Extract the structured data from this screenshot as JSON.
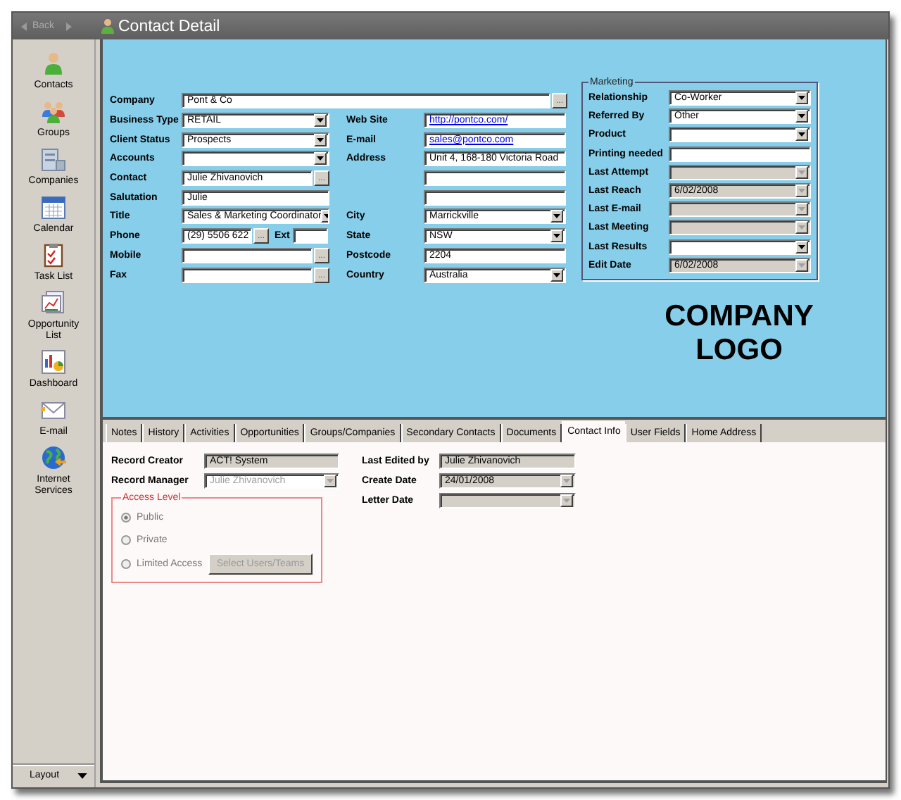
{
  "title_bar": {
    "back": "Back",
    "title": "Contact Detail"
  },
  "sidebar": {
    "items": [
      {
        "label": "Contacts"
      },
      {
        "label": "Groups"
      },
      {
        "label": "Companies"
      },
      {
        "label": "Calendar"
      },
      {
        "label": "Task List"
      },
      {
        "label": "Opportunity List"
      },
      {
        "label": "Dashboard"
      },
      {
        "label": "E-mail"
      },
      {
        "label": "Internet Services"
      }
    ],
    "layout_button": "Layout"
  },
  "company": {
    "label": "Company",
    "value": "Pont & Co",
    "kind": "lookup",
    "button": "..."
  },
  "contact_fields": [
    {
      "label": "Business Type",
      "value": "RETAIL",
      "kind": "combo"
    },
    {
      "label": "Client Status",
      "value": "Prospects",
      "kind": "combo"
    },
    {
      "label": "Accounts",
      "kind": "combo"
    },
    {
      "label": "Contact",
      "value": "Julie Zhivanovich",
      "kind": "lookup",
      "button": "..."
    },
    {
      "label": "Salutation",
      "value": "Julie",
      "kind": "text"
    },
    {
      "label": "Title",
      "value": "Sales & Marketing Coordinator",
      "kind": "combo"
    },
    {
      "label": "Phone",
      "value": "(29) 5506 622",
      "kind": "phone",
      "button": "...",
      "ext_label": "Ext"
    },
    {
      "label": "Mobile",
      "kind": "lookup",
      "button": "..."
    },
    {
      "label": "Fax",
      "kind": "lookup",
      "button": "..."
    }
  ],
  "address_fields": [
    {
      "label": "Web Site",
      "value": "http://pontco.com/",
      "kind": "link"
    },
    {
      "label": "E-mail",
      "value": "sales@pontco.com",
      "kind": "link"
    },
    {
      "label": "Address",
      "value": "Unit 4, 168-180 Victoria Road",
      "kind": "text"
    },
    {
      "kind": "text"
    },
    {
      "kind": "text"
    },
    {
      "label": "City",
      "value": "Marrickville",
      "kind": "combo"
    },
    {
      "label": "State",
      "value": "NSW",
      "kind": "combo"
    },
    {
      "label": "Postcode",
      "value": "2204",
      "kind": "text"
    },
    {
      "label": "Country",
      "value": "Australia",
      "kind": "combo"
    }
  ],
  "marketing": {
    "title": "Marketing",
    "fields": [
      {
        "label": "Relationship",
        "value": "Co-Worker",
        "kind": "combo",
        "read_only": false
      },
      {
        "label": "Referred By",
        "value": "Other",
        "kind": "combo",
        "read_only": false
      },
      {
        "label": "Product",
        "kind": "combo",
        "read_only": false
      },
      {
        "label": "Printing needed",
        "kind": "text",
        "read_only": false
      },
      {
        "label": "Last Attempt",
        "kind": "combo",
        "read_only": true
      },
      {
        "label": "Last Reach",
        "value": "6/02/2008",
        "kind": "combo",
        "read_only": true
      },
      {
        "label": "Last E-mail",
        "kind": "combo",
        "read_only": true
      },
      {
        "label": "Last Meeting",
        "kind": "combo",
        "read_only": true
      },
      {
        "label": "Last Results",
        "kind": "combo",
        "read_only": false
      },
      {
        "label": "Edit Date",
        "value": "6/02/2008",
        "kind": "combo",
        "read_only": true
      }
    ]
  },
  "logo": "COMPANY LOGO",
  "tabs": [
    {
      "label": "Notes",
      "selected": false
    },
    {
      "label": "History",
      "selected": false
    },
    {
      "label": "Activities",
      "selected": false
    },
    {
      "label": "Opportunities",
      "selected": false
    },
    {
      "label": "Groups/Companies",
      "selected": false
    },
    {
      "label": "Secondary Contacts",
      "selected": false
    },
    {
      "label": "Documents",
      "selected": false
    },
    {
      "label": "Contact Info",
      "selected": true
    },
    {
      "label": "User Fields",
      "selected": false
    },
    {
      "label": "Home Address",
      "selected": false
    }
  ],
  "record_fields_left": [
    {
      "label": "Record Creator",
      "value": "ACT! System",
      "kind": "text",
      "read_only": true,
      "disabled": false
    },
    {
      "label": "Record Manager",
      "value": "Julie Zhivanovich",
      "kind": "combo",
      "read_only": false,
      "disabled": true
    }
  ],
  "record_fields_right": [
    {
      "label": "Last Edited by",
      "value": "Julie Zhivanovich",
      "kind": "text",
      "read_only": true,
      "disabled": false
    },
    {
      "label": "Create Date",
      "value": "24/01/2008",
      "kind": "combo",
      "read_only": true,
      "disabled": false
    },
    {
      "label": "Letter Date",
      "kind": "combo",
      "read_only": true,
      "disabled": false
    }
  ],
  "access_level": {
    "title": "Access Level",
    "options": [
      {
        "label": "Public",
        "selected": true
      },
      {
        "label": "Private",
        "selected": false
      },
      {
        "label": "Limited Access",
        "selected": false
      }
    ],
    "button": {
      "label": "Select Users/Teams",
      "disabled": true
    }
  }
}
